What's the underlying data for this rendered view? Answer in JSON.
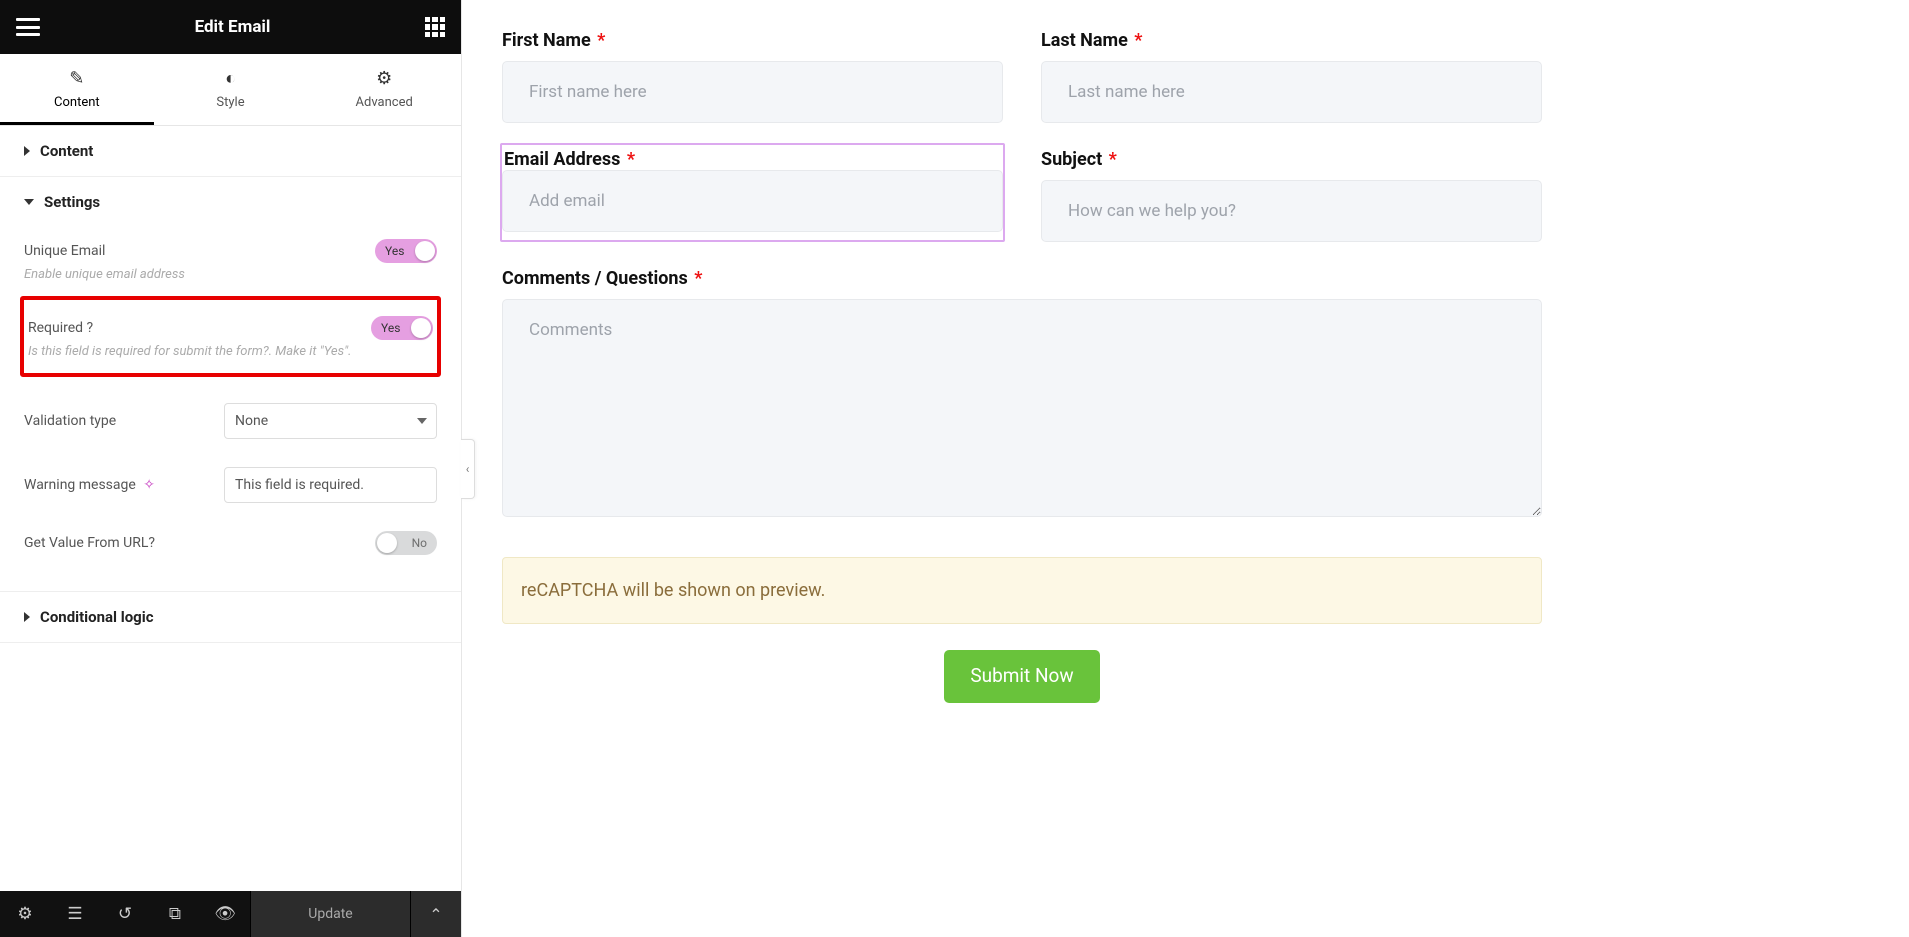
{
  "panel": {
    "title": "Edit Email",
    "tabs": {
      "content": "Content",
      "style": "Style",
      "advanced": "Advanced",
      "active": "content"
    },
    "sections": {
      "content": {
        "label": "Content"
      },
      "settings": {
        "label": "Settings",
        "unique_email": {
          "label": "Unique Email",
          "value": "Yes",
          "desc": "Enable unique email address"
        },
        "required": {
          "label": "Required ?",
          "value": "Yes",
          "desc": "Is this field is required for submit the form?. Make it \"Yes\"."
        },
        "validation": {
          "label": "Validation type",
          "value": "None"
        },
        "warning": {
          "label": "Warning message",
          "value": "This field is required."
        },
        "from_url": {
          "label": "Get Value From URL?",
          "value": "No"
        }
      },
      "conditional": {
        "label": "Conditional logic"
      }
    },
    "footer": {
      "update": "Update"
    }
  },
  "form": {
    "first_name": {
      "label": "First Name",
      "placeholder": "First name here"
    },
    "last_name": {
      "label": "Last Name",
      "placeholder": "Last name here"
    },
    "email": {
      "label": "Email Address",
      "placeholder": "Add email"
    },
    "subject": {
      "label": "Subject",
      "placeholder": "How can we help you?"
    },
    "comments": {
      "label": "Comments / Questions",
      "placeholder": "Comments"
    },
    "recaptcha": "reCAPTCHA will be shown on preview.",
    "submit": "Submit Now"
  }
}
